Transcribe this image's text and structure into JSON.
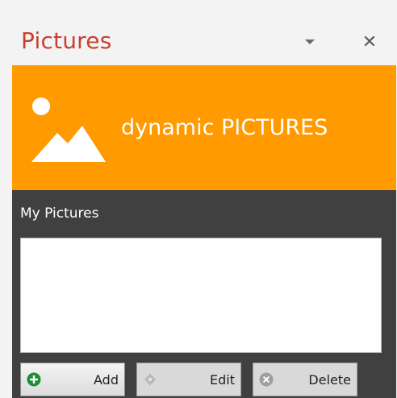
{
  "pane": {
    "title": "Pictures",
    "menu_icon": "dropdown-triangle-icon",
    "close_icon": "close-icon",
    "close_glyph": "✕"
  },
  "banner": {
    "icon": "picture-icon",
    "text": "dynamic PICTURES",
    "background_color": "#ff9a00"
  },
  "content": {
    "section_label": "My Pictures",
    "background_color": "#404040",
    "buttons": [
      {
        "label": "Add",
        "icon": "add-icon",
        "enabled": true
      },
      {
        "label": "Edit",
        "icon": "gear-icon",
        "enabled": false
      },
      {
        "label": "Delete",
        "icon": "delete-icon",
        "enabled": false
      }
    ]
  },
  "colors": {
    "title": "#c8402f",
    "add_icon": "#1f8f37"
  }
}
